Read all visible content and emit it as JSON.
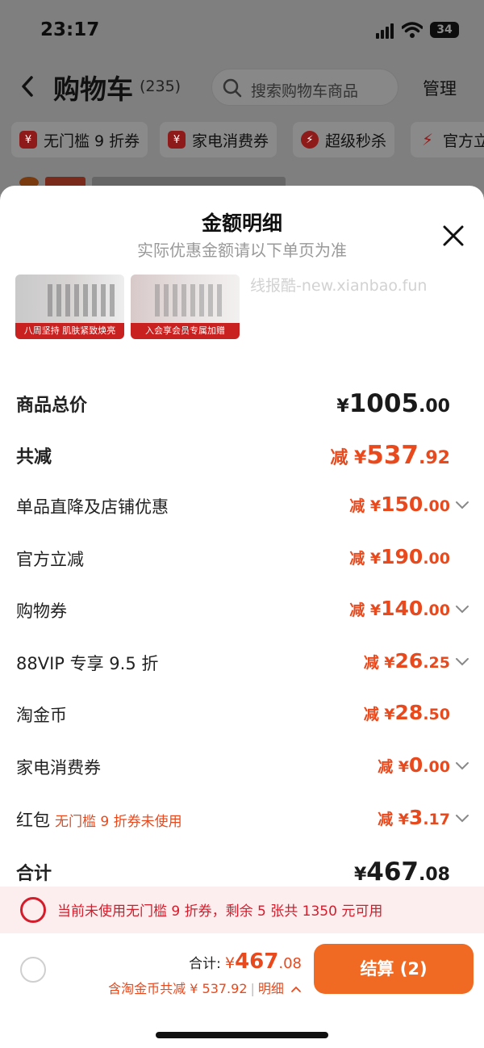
{
  "status": {
    "time": "23:17",
    "battery": "34"
  },
  "nav": {
    "title": "购物车",
    "count": "(235)",
    "search_placeholder": "搜索购物车商品",
    "manage": "管理"
  },
  "chips": [
    {
      "icon": "¥",
      "label": "无门槛 9 折券"
    },
    {
      "icon": "¥",
      "label": "家电消费券"
    },
    {
      "icon": "⚡",
      "label": "超级秒杀"
    },
    {
      "icon": "⚡",
      "label": "官方立"
    }
  ],
  "sheet": {
    "title": "金额明细",
    "subtitle": "实际优惠金额请以下单页为准",
    "watermark": "线报酷-new.xianbao.fun",
    "thumbs": [
      {
        "caption": "八周坚持 肌肤紧致焕亮"
      },
      {
        "caption": "入会享会员专属加赠"
      }
    ],
    "rows": [
      {
        "label": "商品总价",
        "prefix": "",
        "int": "1005",
        "dec": ".00"
      },
      {
        "label": "共减",
        "prefix": "减 ¥",
        "int": "537",
        "dec": ".92"
      },
      {
        "label": "单品直降及店铺优惠",
        "prefix": "减 ¥",
        "int": "150",
        "dec": ".00"
      },
      {
        "label": "官方立减",
        "prefix": "减 ¥",
        "int": "190",
        "dec": ".00"
      },
      {
        "label": "购物券",
        "prefix": "减 ¥",
        "int": "140",
        "dec": ".00"
      },
      {
        "label": "88VIP 专享 9.5 折",
        "prefix": "减 ¥",
        "int": "26",
        "dec": ".25"
      },
      {
        "label": "淘金币",
        "prefix": "减 ¥",
        "int": "28",
        "dec": ".50"
      },
      {
        "label": "家电消费券",
        "prefix": "减 ¥",
        "int": "0",
        "dec": ".00"
      },
      {
        "label": "红包",
        "hint": "无门槛 9 折券未使用",
        "prefix": "减 ¥",
        "int": "3",
        "dec": ".17"
      },
      {
        "label": "合计",
        "prefix": "",
        "int": "467",
        "dec": ".08"
      }
    ],
    "currency": "¥"
  },
  "banner": {
    "text": "当前未使用无门槛 9 折券，剩余 5 张共 1350 元可用"
  },
  "footer": {
    "total_label": "合计:",
    "currency": "¥",
    "total_int": "467",
    "total_dec": ".08",
    "sub_text": "含淘金币共减 ¥ 537.92",
    "detail": "明细",
    "checkout": "结算 (2)"
  },
  "colors": {
    "accent": "#e8491d",
    "checkout": "#f06a23",
    "banner_text": "#d41c2b"
  }
}
